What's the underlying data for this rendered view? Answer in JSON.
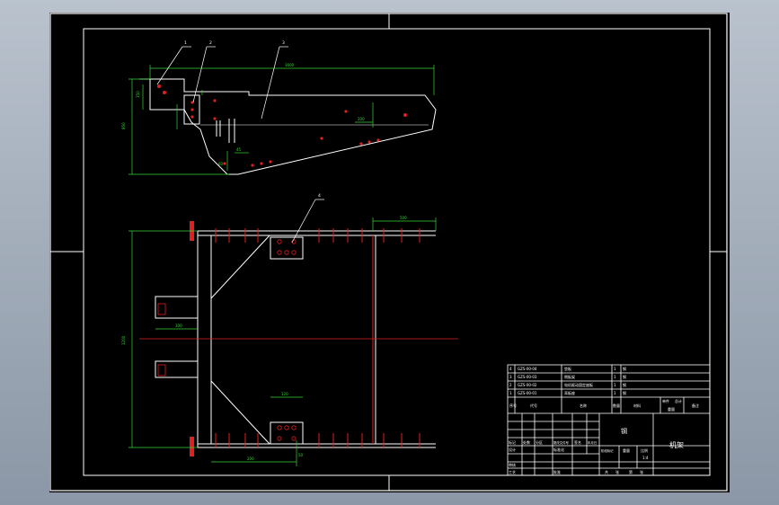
{
  "drawing": {
    "title_block": {
      "part_name": "机架",
      "material": "钢",
      "headers": [
        "序号",
        "代号",
        "名称",
        "数量",
        "材料",
        "单件",
        "总计",
        "备注"
      ],
      "mass_header": "重量",
      "scale_header": "比例",
      "stage_labels": [
        "标记",
        "处数",
        "分区",
        "更改文件号",
        "签名",
        "年月日",
        "阶段标记",
        "重量",
        "比例",
        "设计",
        "标准化",
        "审核",
        "工艺",
        "批准",
        "共",
        "张",
        "第",
        "张"
      ],
      "bom": [
        {
          "no": "4",
          "code": "GZS-00-04",
          "name": "垫板",
          "qty": "1",
          "mat": "钢"
        },
        {
          "no": "3",
          "code": "GZS-00-03",
          "name": "侧板架",
          "qty": "1",
          "mat": "钢"
        },
        {
          "no": "2",
          "code": "GZS-00-02",
          "name": "电机驱动固定座板",
          "qty": "1",
          "mat": "钢"
        },
        {
          "no": "1",
          "code": "GZS-00-01",
          "name": "耳板座",
          "qty": "1",
          "mat": "钢"
        }
      ],
      "scale": "1:4",
      "qty_total": "1"
    },
    "balloons": [
      "1",
      "2",
      "3",
      "4"
    ],
    "dims": {
      "top_len": "3600",
      "height": "850",
      "left_h": "350",
      "small_a": "200",
      "small_b": "45",
      "small_c": "60",
      "plan_width": "1200",
      "plan_w2": "500",
      "plan_b": "300",
      "plan_c": "200",
      "plan_d": "120",
      "plan_e": "50"
    }
  }
}
